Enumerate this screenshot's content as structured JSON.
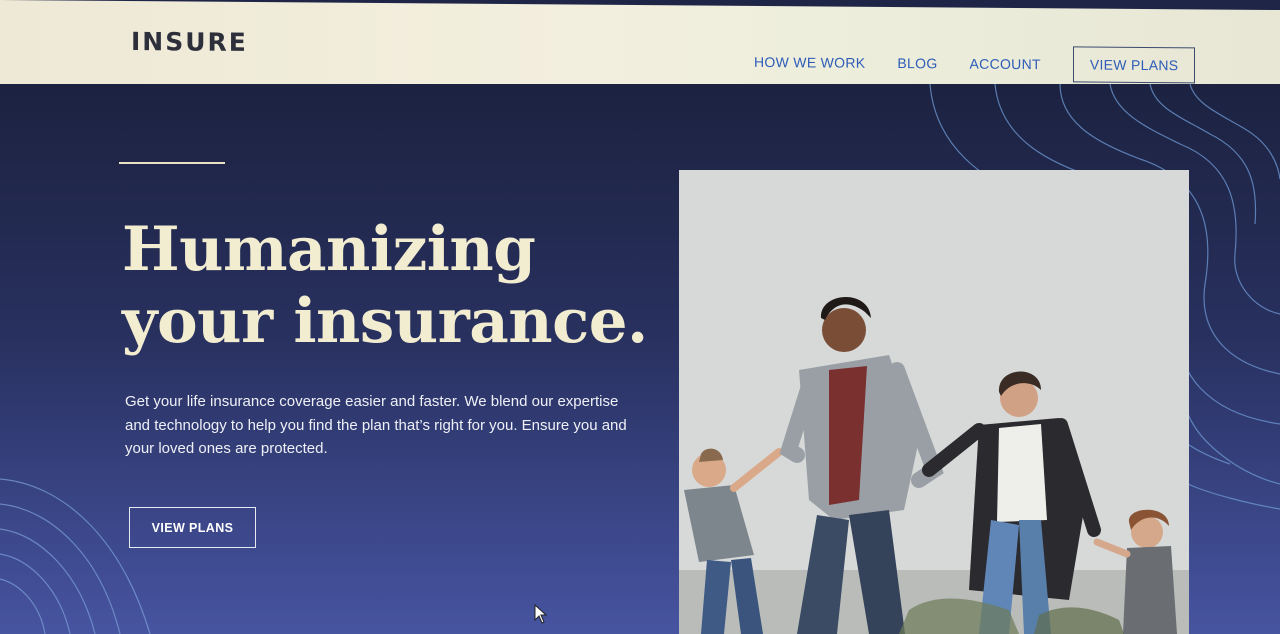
{
  "header": {
    "logo": "INSURE",
    "nav": [
      {
        "label": "HOW WE WORK"
      },
      {
        "label": "BLOG"
      },
      {
        "label": "ACCOUNT"
      }
    ],
    "cta_label": "VIEW PLANS"
  },
  "hero": {
    "title_line1": "Humanizing",
    "title_line2": "your insurance.",
    "description": "Get your life insurance coverage easier and faster. We blend our expertise and technology to help you find the plan that’s right for you. Ensure you and your loved ones are protected.",
    "cta_label": "VIEW PLANS",
    "image_icon": "family-photo"
  },
  "colors": {
    "header_bg": "#f0ecd9",
    "hero_dark": "#1c2240",
    "hero_light": "#4754a0",
    "title": "#f2ecd0",
    "nav_link": "#2f5db8"
  }
}
